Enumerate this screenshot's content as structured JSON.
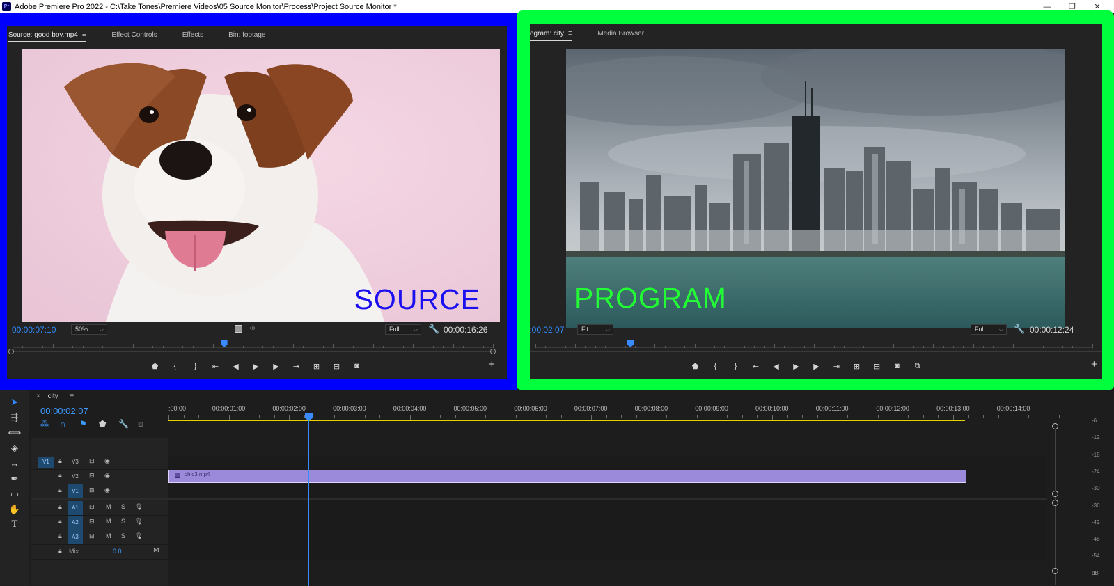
{
  "window": {
    "app_logo": "Pr",
    "title": "Adobe Premiere Pro 2022 - C:\\Take Tones\\Premiere Videos\\05 Source Monitor\\Process\\Project Source Monitor *",
    "minimize": "—",
    "restore": "❐",
    "close": "✕"
  },
  "source_monitor": {
    "tabs": [
      {
        "label": "Source: good boy.mp4",
        "menu": "≡"
      },
      {
        "label": "Effect Controls"
      },
      {
        "label": "Effects"
      },
      {
        "label": "Bin: footage"
      }
    ],
    "overlay": "SOURCE",
    "timecode": "00:00:07:10",
    "zoom": "50%",
    "resolution": "Full",
    "duration": "00:00:16:26",
    "playhead_fraction": 0.44
  },
  "program_monitor": {
    "tabs": [
      {
        "label": "ogram: city",
        "menu": "≡"
      },
      {
        "label": "Media Browser"
      }
    ],
    "overlay": "PROGRAM",
    "timecode": "00:00:02:07",
    "zoom": "Fit",
    "resolution": "Full",
    "duration": "00:00:12:24",
    "playhead_fraction": 0.17
  },
  "timeline": {
    "sequence_name": "city",
    "close": "×",
    "menu": "≡",
    "timecode": "00:00:02:07",
    "ruler_labels": [
      ":00:00",
      "00:00:01:00",
      "00:00:02:00",
      "00:00:03:00",
      "00:00:04:00",
      "00:00:05:00",
      "00:00:06:00",
      "00:00:07:00",
      "00:00:08:00",
      "00:00:09:00",
      "00:00:10:00",
      "00:00:11:00",
      "00:00:12:00",
      "00:00:13:00",
      "00:00:14:00"
    ],
    "source_patch_v": "V1",
    "video_tracks": [
      "V3",
      "V2",
      "V1"
    ],
    "audio_tracks": [
      "A1",
      "A2",
      "A3"
    ],
    "audio_mute": "M",
    "audio_solo": "S",
    "mix_label": "Mix",
    "mix_value": "0.0",
    "clip_name": "chic3.mp4",
    "meter_labels": [
      "-6",
      "-12",
      "-18",
      "-24",
      "-30",
      "-36",
      "-42",
      "-48",
      "-54",
      "dB"
    ]
  },
  "colors": {
    "source_frame": "#0000ff",
    "program_frame": "#00ff3c",
    "timecode_blue": "#2f8cff",
    "clip_purple": "#9b8ad9",
    "work_area_yellow": "#e4d200"
  }
}
